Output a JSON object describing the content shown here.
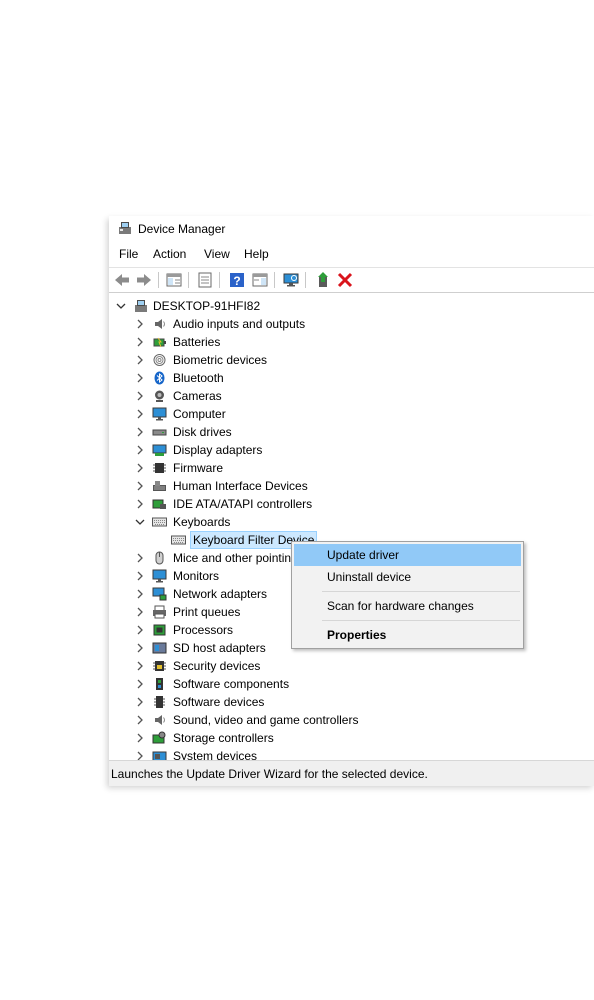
{
  "window": {
    "title": "Device Manager"
  },
  "menu": [
    "File",
    "Action",
    "View",
    "Help"
  ],
  "toolbar_icons": [
    "back-icon",
    "forward-icon",
    "show-hide-console-tree-icon",
    "properties-icon",
    "help-icon",
    "action-pane-icon",
    "scan-hardware-icon",
    "update-driver-icon",
    "uninstall-device-icon"
  ],
  "tree": {
    "root": "DESKTOP-91HFI82",
    "categories": [
      {
        "label": "Audio inputs and outputs",
        "icon": "speaker-icon"
      },
      {
        "label": "Batteries",
        "icon": "battery-icon"
      },
      {
        "label": "Biometric devices",
        "icon": "fingerprint-icon"
      },
      {
        "label": "Bluetooth",
        "icon": "bluetooth-icon"
      },
      {
        "label": "Cameras",
        "icon": "camera-icon"
      },
      {
        "label": "Computer",
        "icon": "computer-icon"
      },
      {
        "label": "Disk drives",
        "icon": "disk-drive-icon"
      },
      {
        "label": "Display adapters",
        "icon": "display-adapter-icon"
      },
      {
        "label": "Firmware",
        "icon": "firmware-chip-icon"
      },
      {
        "label": "Human Interface Devices",
        "icon": "hid-icon"
      },
      {
        "label": "IDE ATA/ATAPI controllers",
        "icon": "ide-controller-icon"
      },
      {
        "label": "Keyboards",
        "icon": "keyboard-icon",
        "expanded": true
      },
      {
        "label": "Keyboard Filter Device",
        "icon": "keyboard-icon",
        "child": true,
        "selected": true
      },
      {
        "label": "Mice and other pointin",
        "icon": "mouse-icon"
      },
      {
        "label": "Monitors",
        "icon": "monitor-icon"
      },
      {
        "label": "Network adapters",
        "icon": "network-adapter-icon"
      },
      {
        "label": "Print queues",
        "icon": "printer-icon"
      },
      {
        "label": "Processors",
        "icon": "processor-icon"
      },
      {
        "label": "SD host adapters",
        "icon": "sd-card-icon"
      },
      {
        "label": "Security devices",
        "icon": "security-chip-icon"
      },
      {
        "label": "Software components",
        "icon": "software-component-icon"
      },
      {
        "label": "Software devices",
        "icon": "software-device-icon"
      },
      {
        "label": "Sound, video and game controllers",
        "icon": "speaker-icon"
      },
      {
        "label": "Storage controllers",
        "icon": "storage-controller-icon"
      },
      {
        "label": "System devices",
        "icon": "system-device-icon"
      }
    ]
  },
  "context_menu": {
    "items": [
      "Update driver",
      "Uninstall device",
      "Scan for hardware changes",
      "Properties"
    ],
    "highlighted": "Update driver"
  },
  "status": "Launches the Update Driver Wizard for the selected device.",
  "colors": {
    "selection_bg": "#cce8ff",
    "menu_highlight": "#91c9f7",
    "uninstall_red": "#d9141c",
    "update_green": "#2e9e3a"
  }
}
